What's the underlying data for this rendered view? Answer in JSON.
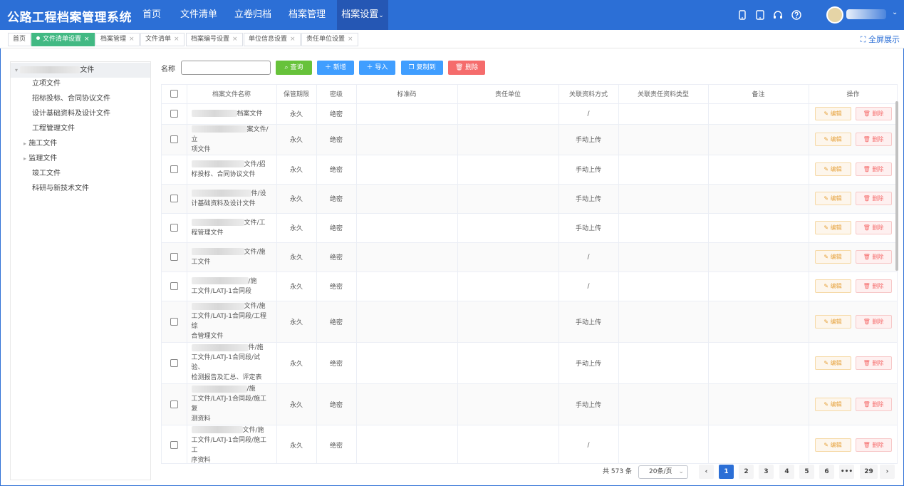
{
  "app": {
    "title": "公路工程档案管理系统"
  },
  "nav": [
    "首页",
    "文件清单",
    "立卷归档",
    "档案管理",
    "档案设置"
  ],
  "icons": [
    "phone-icon",
    "tablet-icon",
    "headset-icon",
    "help-icon",
    "avatar",
    "chevron-down-icon"
  ],
  "tabs": {
    "items": [
      "首页",
      "文件清单设置",
      "档案管理",
      "文件清单",
      "档案编号设置",
      "单位信息设置",
      "责任单位设置"
    ],
    "close": "×",
    "fullscreen": "全屏展示"
  },
  "tree": {
    "root_suffix": "文件",
    "items": [
      "立项文件",
      "招标投标、合同协议文件",
      "设计基础资料及设计文件",
      "工程管理文件",
      "施工文件",
      "监理文件",
      "竣工文件",
      "科研与新技术文件"
    ],
    "arrow": "▸",
    "root_arrow": "▾"
  },
  "search": {
    "label": "名称",
    "placeholder": ""
  },
  "buttons": {
    "query": "查询",
    "add": "新增",
    "import": "导入",
    "copy": "复制到",
    "delete": "删除"
  },
  "colors": {
    "primary": "#2c6fd6",
    "success": "#67c23a",
    "blue": "#409eff",
    "danger": "#f56c6c",
    "warning": "#e6a23c"
  },
  "table": {
    "headers": [
      "档案文件名称",
      "保管期限",
      "密级",
      "标准码",
      "责任单位",
      "关联资料方式",
      "关联责任资料类型",
      "备注",
      "操作"
    ],
    "edit_label": "编辑",
    "delete_label": "删除",
    "rows": [
      {
        "name_lines": [
          "档案文件"
        ],
        "period": "永久",
        "secret": "绝密",
        "method": "/"
      },
      {
        "name_lines": [
          "案文件/立",
          "项文件"
        ],
        "period": "永久",
        "secret": "绝密",
        "method": "手动上传"
      },
      {
        "name_lines": [
          "文件/招",
          "标投标、合同协议文件"
        ],
        "period": "永久",
        "secret": "绝密",
        "method": "手动上传"
      },
      {
        "name_lines": [
          "件/设",
          "计基础资料及设计文件"
        ],
        "period": "永久",
        "secret": "绝密",
        "method": "手动上传"
      },
      {
        "name_lines": [
          "文件/工",
          "程管理文件"
        ],
        "period": "永久",
        "secret": "绝密",
        "method": "手动上传"
      },
      {
        "name_lines": [
          "文件/施",
          "工文件"
        ],
        "period": "永久",
        "secret": "绝密",
        "method": "/"
      },
      {
        "name_lines": [
          "/施",
          "工文件/LATJ-1合同段"
        ],
        "period": "永久",
        "secret": "绝密",
        "method": "/"
      },
      {
        "name_lines": [
          "文件/施",
          "工文件/LATJ-1合同段/工程综",
          "合管理文件"
        ],
        "period": "永久",
        "secret": "绝密",
        "method": "手动上传"
      },
      {
        "name_lines": [
          "件/施",
          "工文件/LATJ-1合同段/试验、",
          "检测报告及汇总、评定表"
        ],
        "period": "永久",
        "secret": "绝密",
        "method": "手动上传"
      },
      {
        "name_lines": [
          "/施",
          "工文件/LATJ-1合同段/施工复",
          "测资料"
        ],
        "period": "永久",
        "secret": "绝密",
        "method": "手动上传"
      },
      {
        "name_lines": [
          "文件/施",
          "工文件/LATJ-1合同段/施工工",
          "序资料"
        ],
        "period": "永久",
        "secret": "绝密",
        "method": "/"
      }
    ]
  },
  "pagination": {
    "total": "共 573 条",
    "page_size": "20条/页",
    "pages": [
      "1",
      "2",
      "3",
      "4",
      "5",
      "6",
      "•••",
      "29"
    ],
    "current": "1",
    "prev": "‹",
    "next": "›"
  }
}
